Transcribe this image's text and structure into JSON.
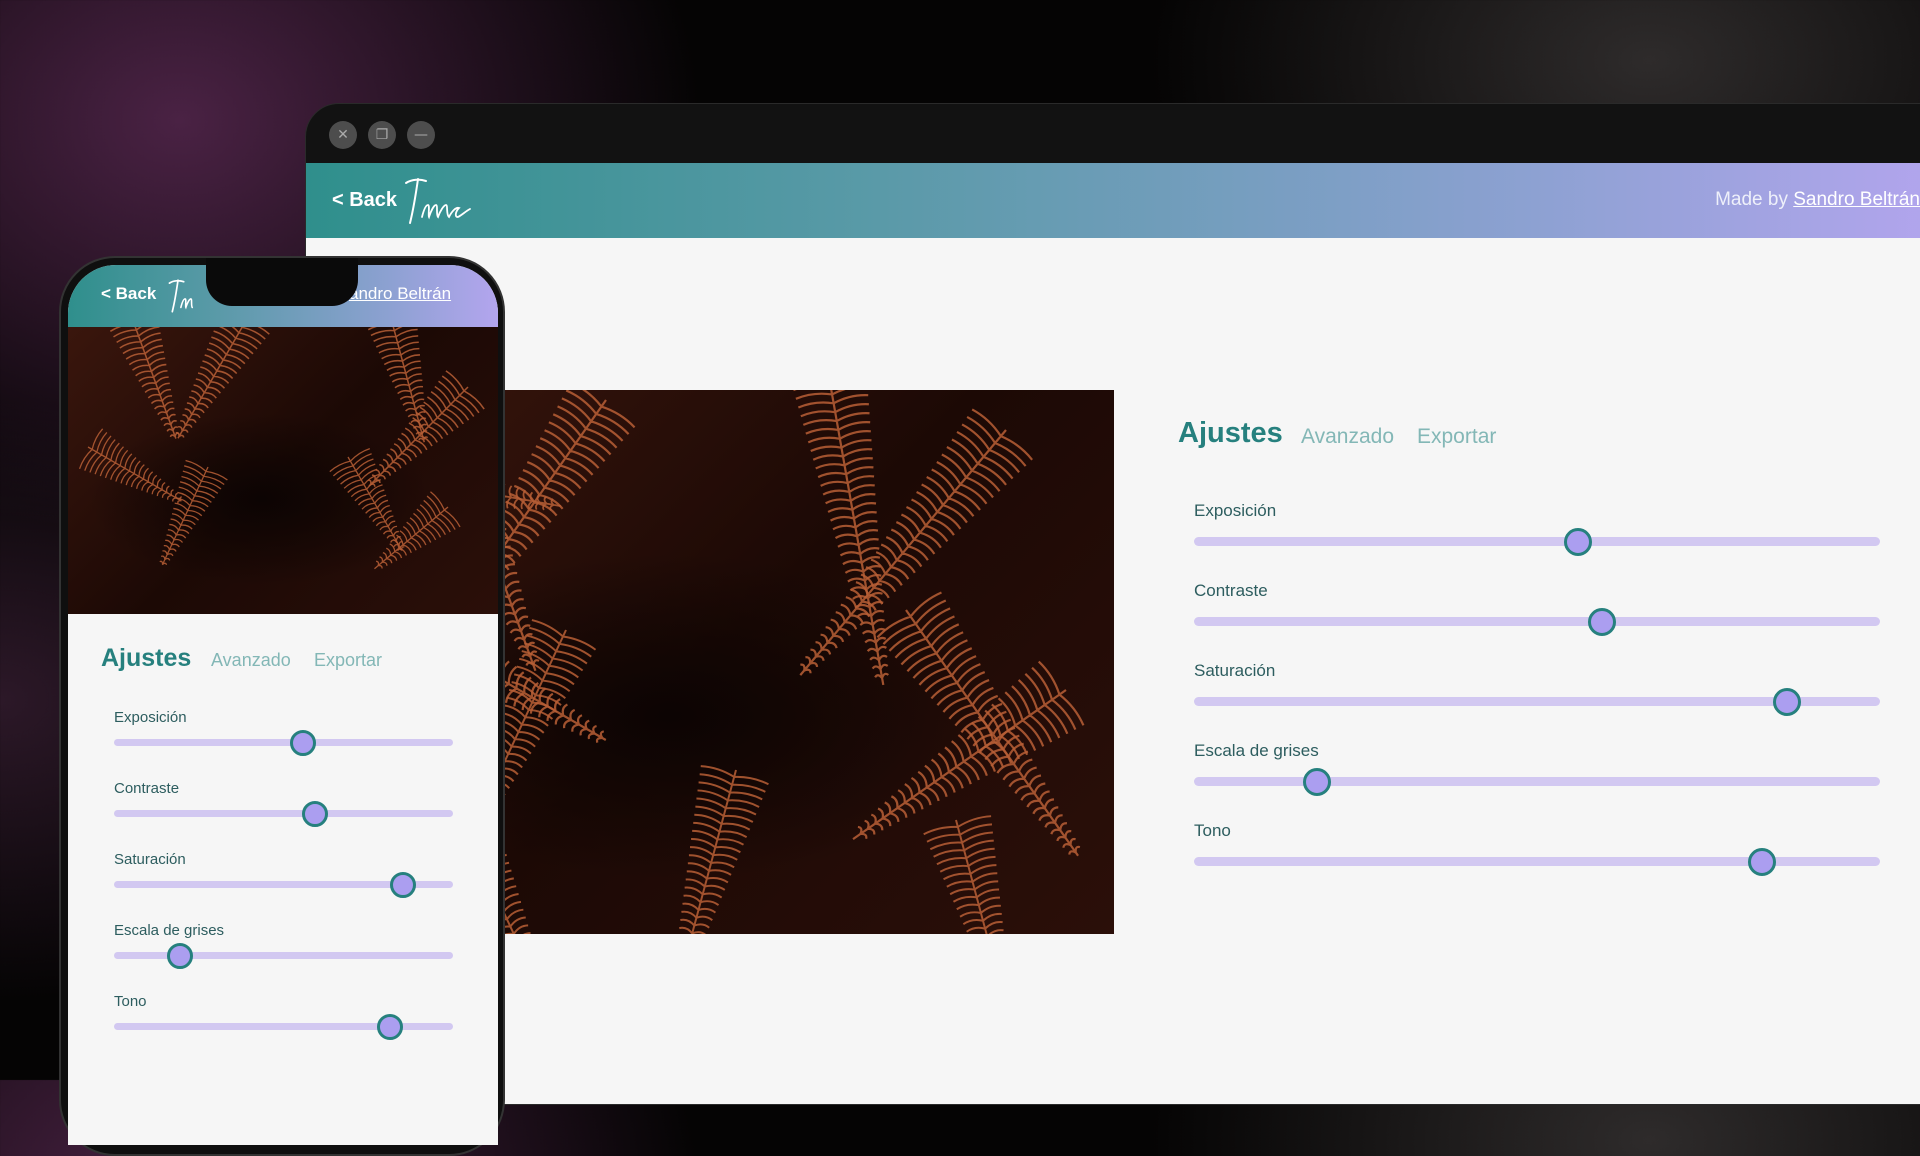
{
  "desktop": {
    "window_controls": {
      "close": "✕",
      "restore": "❐",
      "minimize": "—"
    },
    "header": {
      "back_label": "< Back",
      "logo_text": "Ima",
      "made_by_prefix": "Made by ",
      "made_by_author": "Sandro Beltrán"
    },
    "tabs": [
      {
        "label": "Ajustes",
        "active": true
      },
      {
        "label": "Avanzado",
        "active": false
      },
      {
        "label": "Exportar",
        "active": false
      }
    ],
    "sliders": [
      {
        "label": "Exposición",
        "value": 0.56
      },
      {
        "label": "Contraste",
        "value": 0.595
      },
      {
        "label": "Saturación",
        "value": 0.865
      },
      {
        "label": "Escala de grises",
        "value": 0.18
      },
      {
        "label": "Tono",
        "value": 0.828
      }
    ]
  },
  "mobile": {
    "header": {
      "back_label": "< Back",
      "logo_text": "Ima",
      "made_by_author_visible": "andro Beltrán"
    },
    "tabs": [
      {
        "label": "Ajustes",
        "active": true
      },
      {
        "label": "Avanzado",
        "active": false
      },
      {
        "label": "Exportar",
        "active": false
      }
    ],
    "sliders": [
      {
        "label": "Exposición",
        "value": 0.557
      },
      {
        "label": "Contraste",
        "value": 0.594
      },
      {
        "label": "Saturación",
        "value": 0.853
      },
      {
        "label": "Escala de grises",
        "value": 0.196
      },
      {
        "label": "Tono",
        "value": 0.815
      }
    ]
  },
  "colors": {
    "accent_teal": "#26807e",
    "slider_track": "#d2c8f1",
    "slider_thumb": "#ab9ef0",
    "header_gradient_start": "#2f8f8c",
    "header_gradient_end": "#b3a5ee",
    "photo_fern": "#b85f36"
  },
  "icons": {
    "close": "close-icon",
    "restore": "restore-icon",
    "minimize": "minimize-icon",
    "logo": "signature-logo"
  }
}
